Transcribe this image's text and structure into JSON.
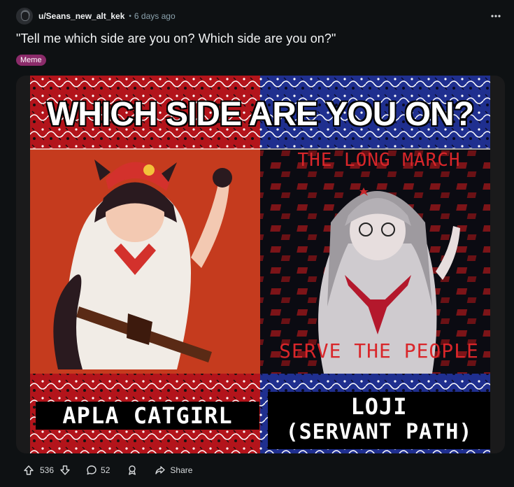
{
  "post": {
    "author": "u/Seans_new_alt_kek",
    "separator": "•",
    "time_ago": "6 days ago",
    "title": "\"Tell me which side are you on? Which side are you on?\"",
    "flair": "Meme"
  },
  "meme": {
    "headline": "WHICH SIDE ARE YOU ON?",
    "right_top_caption": "THE LONG MARCH",
    "right_bottom_caption": "SERVE THE PEOPLE",
    "left_name": "APLA CATGIRL",
    "right_name_line1": "LOJI",
    "right_name_line2": "(SERVANT PATH)"
  },
  "actions": {
    "upvotes": "536",
    "comments": "52",
    "share_label": "Share"
  },
  "icons": {
    "overflow": "more-horizontal-icon",
    "upvote": "arrow-up-icon",
    "downvote": "arrow-down-icon",
    "comment": "comment-icon",
    "award": "award-icon",
    "share": "share-icon"
  },
  "colors": {
    "background": "#0e1113",
    "flair_bg": "#8b2b6a",
    "left_panel": "#c53b1e",
    "right_panel": "#0b0b12",
    "bandana_red": "#b3141b",
    "bandana_blue": "#1f2f8f"
  }
}
